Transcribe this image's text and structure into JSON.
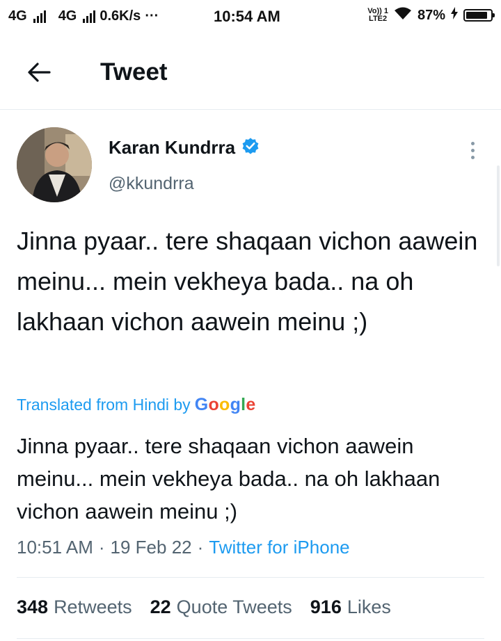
{
  "status_bar": {
    "network_1": "4G",
    "network_2": "4G",
    "speed": "0.6K/s",
    "more": "···",
    "time": "10:54 AM",
    "volte_line1": "Vo)) 1",
    "volte_line2": "LTE2",
    "battery_percent": "87%",
    "battery_level": 0.87
  },
  "header": {
    "title": "Tweet"
  },
  "author": {
    "name": "Karan Kundrra",
    "handle": "@kkundrra",
    "verified": true
  },
  "tweet": {
    "text": "Jinna pyaar.. tere shaqaan vichon aawein meinu... mein vekheya bada.. na oh lakhaan vichon aawein meinu ;)",
    "translated_label": "Translated from Hindi by",
    "translator": "Google",
    "translation": "Jinna pyaar.. tere shaqaan vichon aawein meinu... mein vekheya bada.. na oh lakhaan vichon aawein meinu ;)",
    "time": "10:51 AM",
    "date": "19 Feb 22",
    "source": "Twitter for iPhone",
    "separator": "·"
  },
  "stats": {
    "retweets_count": "348",
    "retweets_label": "Retweets",
    "quotes_count": "22",
    "quotes_label": "Quote Tweets",
    "likes_count": "916",
    "likes_label": "Likes"
  },
  "colors": {
    "accent": "#1d9bf0",
    "secondary_text": "#536471",
    "verified": "#1d9bf0"
  }
}
